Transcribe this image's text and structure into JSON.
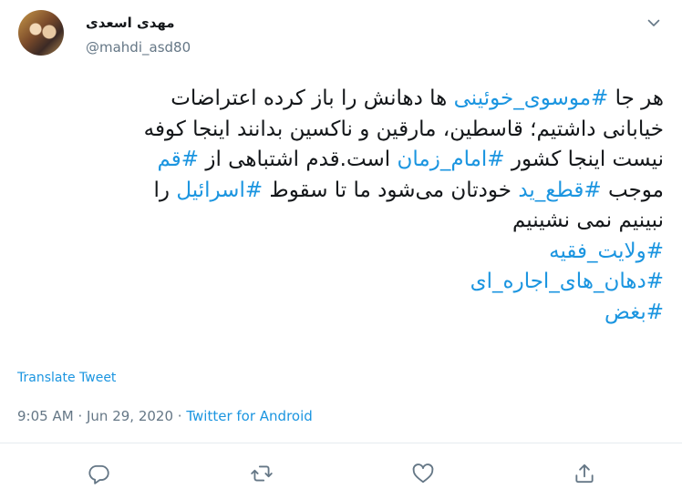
{
  "user": {
    "display_name": "مهدی اسعدی",
    "handle": "@mahdi_asd80"
  },
  "tweet": {
    "lines": [
      [
        {
          "t": "هر جا ",
          "h": false
        },
        {
          "t": "#موسوی_خوئینی",
          "h": true
        },
        {
          "t": " ها دهانش را باز کرده اعتراضات",
          "h": false
        }
      ],
      [
        {
          "t": "خیابانی داشتیم؛ قاسطین، مارقین و ناکسین بدانند اینجا کوفه",
          "h": false
        }
      ],
      [
        {
          "t": "نیست اینجا کشور ",
          "h": false
        },
        {
          "t": "#امام_زمان",
          "h": true
        },
        {
          "t": " است.قدم اشتباهی از ",
          "h": false
        },
        {
          "t": "#قم",
          "h": true
        }
      ],
      [
        {
          "t": "موجب ",
          "h": false
        },
        {
          "t": "#قطع_ید",
          "h": true
        },
        {
          "t": " خودتان می‌شود ما تا سقوط ",
          "h": false
        },
        {
          "t": "#اسرائیل",
          "h": true
        },
        {
          "t": " را",
          "h": false
        }
      ],
      [
        {
          "t": "نبینیم نمی نشینیم",
          "h": false
        }
      ],
      [
        {
          "t": "#ولایت_فقیه",
          "h": true
        }
      ],
      [
        {
          "t": "#دهان_های_اجاره_ای",
          "h": true
        }
      ],
      [
        {
          "t": "#بغض",
          "h": true
        }
      ]
    ],
    "translate_label": "Translate Tweet",
    "time": "9:05 AM",
    "separator": "·",
    "date": "Jun 29, 2020",
    "source": "Twitter for Android"
  },
  "colors": {
    "accent": "#1b95e0",
    "muted": "#657786",
    "text": "#14171a"
  },
  "icons": {
    "menu": "chevron-down-icon",
    "reply": "reply-icon",
    "retweet": "retweet-icon",
    "like": "like-icon",
    "share": "share-icon"
  }
}
